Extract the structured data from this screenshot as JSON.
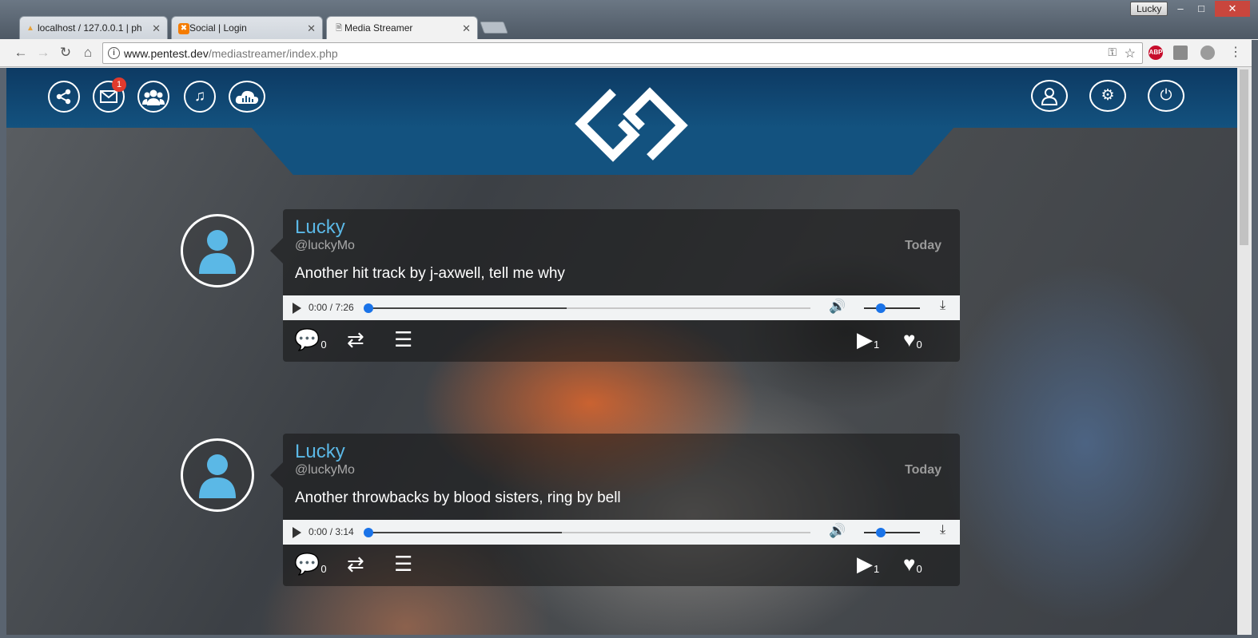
{
  "browser": {
    "profile_name": "Lucky",
    "tabs": [
      {
        "title": "localhost / 127.0.0.1 | ph",
        "favicon": "PMA",
        "active": false
      },
      {
        "title": "Social | Login",
        "favicon": "xampp-icon",
        "active": false
      },
      {
        "title": "Media Streamer",
        "favicon": "page-icon",
        "active": true
      }
    ],
    "url_host": "www.pentest.dev",
    "url_path": "/mediastreamer/index.php",
    "extensions": [
      {
        "label": "ABP",
        "color": "#c70d2c"
      }
    ]
  },
  "header": {
    "nav_icons": [
      "share-icon",
      "mail-icon",
      "users-icon",
      "music-icon",
      "cloud-icon"
    ],
    "mail_badge": "1",
    "right_icons": [
      "user-icon",
      "gear-icon",
      "power-icon"
    ],
    "accent_color": "#13527f"
  },
  "posts": [
    {
      "name": "Lucky",
      "handle": "@luckyMo",
      "date": "Today",
      "message": "Another hit track by j-axwell, tell me why",
      "player": {
        "time": "0:00 / 7:26",
        "buffered_fraction": 0.45,
        "volume_fraction": 0.3
      },
      "comments": "0",
      "plays": "1",
      "likes": "0"
    },
    {
      "name": "Lucky",
      "handle": "@luckyMo",
      "date": "Today",
      "message": "Another throwbacks by blood sisters, ring by bell",
      "player": {
        "time": "0:00 / 3:14",
        "buffered_fraction": 0.44,
        "volume_fraction": 0.3
      },
      "comments": "0",
      "plays": "1",
      "likes": "0"
    }
  ]
}
